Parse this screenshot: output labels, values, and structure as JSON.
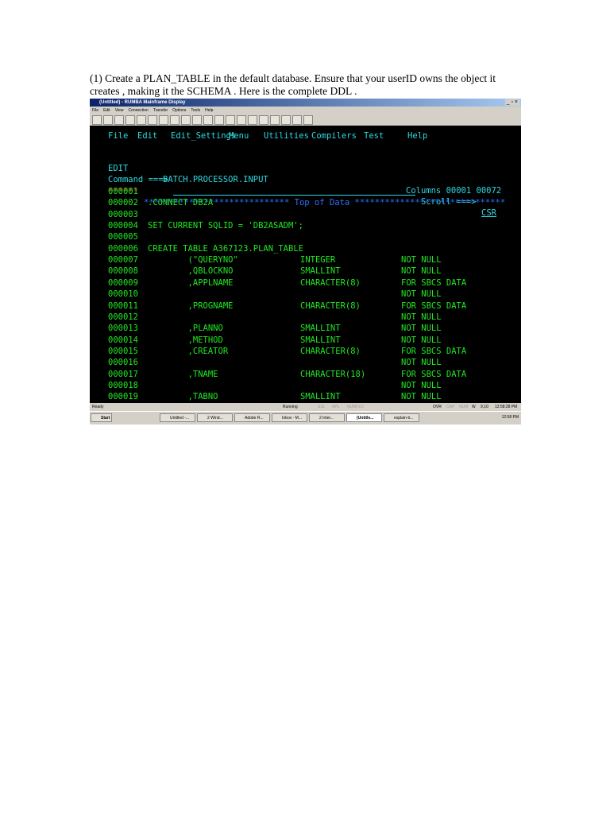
{
  "caption": "(1) Create a PLAN_TABLE  in the default database. Ensure that your userID owns the object it creates , making it the SCHEMA . Here is the complete DDL .",
  "window": {
    "title": "(Untitled) - RUMBA Mainframe Display",
    "controls": "_ ▫ ×",
    "menu": [
      "File",
      "Edit",
      "View",
      "Connection",
      "Transfer",
      "Options",
      "Tools",
      "Help"
    ]
  },
  "ispf": {
    "menu": [
      "File",
      "Edit",
      "Edit_Settings",
      "Menu",
      "Utilities",
      "Compilers",
      "Test",
      "Help"
    ],
    "mode": "EDIT",
    "dataset": "BATCH.PROCESSOR.INPUT",
    "columns": "Columns 00001 00072",
    "command_label": "Command ===>",
    "command_value": "",
    "scroll_label": "Scroll ===>",
    "scroll_value": "CSR",
    "top_marker": "******",
    "top_text": "***************************** Top of Data ******************************",
    "rows": [
      {
        "num": "000001",
        "code": "",
        "type": "",
        "attr": ""
      },
      {
        "num": "000002",
        "code": ".CONNECT DB2A",
        "type": "",
        "attr": ""
      },
      {
        "num": "000003",
        "code": "",
        "type": "",
        "attr": ""
      },
      {
        "num": "000004",
        "code": "SET CURRENT SQLID = 'DB2ASADM';",
        "type": "",
        "attr": ""
      },
      {
        "num": "000005",
        "code": "",
        "type": "",
        "attr": ""
      },
      {
        "num": "000006",
        "code": "CREATE TABLE A367123.PLAN_TABLE",
        "type": "",
        "attr": ""
      },
      {
        "num": "000007",
        "code": "        (\"QUERYNO\"",
        "type": "INTEGER",
        "attr": "NOT NULL"
      },
      {
        "num": "000008",
        "code": "        ,QBLOCKNO",
        "type": "SMALLINT",
        "attr": "NOT NULL"
      },
      {
        "num": "000009",
        "code": "        ,APPLNAME",
        "type": "CHARACTER(8)",
        "attr": "FOR SBCS DATA"
      },
      {
        "num": "000010",
        "code": "",
        "type": "",
        "attr": "NOT NULL"
      },
      {
        "num": "000011",
        "code": "        ,PROGNAME",
        "type": "CHARACTER(8)",
        "attr": "FOR SBCS DATA"
      },
      {
        "num": "000012",
        "code": "",
        "type": "",
        "attr": "NOT NULL"
      },
      {
        "num": "000013",
        "code": "        ,PLANNO",
        "type": "SMALLINT",
        "attr": "NOT NULL"
      },
      {
        "num": "000014",
        "code": "        ,METHOD",
        "type": "SMALLINT",
        "attr": "NOT NULL"
      },
      {
        "num": "000015",
        "code": "        ,CREATOR",
        "type": "CHARACTER(8)",
        "attr": "FOR SBCS DATA"
      },
      {
        "num": "000016",
        "code": "",
        "type": "",
        "attr": "NOT NULL"
      },
      {
        "num": "000017",
        "code": "        ,TNAME",
        "type": "CHARACTER(18)",
        "attr": "FOR SBCS DATA"
      },
      {
        "num": "000018",
        "code": "",
        "type": "",
        "attr": "NOT NULL"
      },
      {
        "num": "000019",
        "code": "        ,TABNO",
        "type": "SMALLINT",
        "attr": "NOT NULL"
      }
    ]
  },
  "status": {
    "ready": "Ready",
    "running": "Running",
    "ssl": "SSL",
    "apl": "APL",
    "numfld": "NUMFLD",
    "ovr": "OVR",
    "cap": "CAP",
    "num": "NUM",
    "w": "W",
    "pos": "9,10",
    "time": "12:58:28 PM"
  },
  "taskbar": {
    "start": "Start",
    "tasks": [
      "Untitled -...",
      "2 Wind...",
      "Adobe R...",
      "Inbox - M...",
      "2 Inter...",
      "(Untitle...",
      "explain-tr..."
    ],
    "clock": "12:58 PM"
  }
}
